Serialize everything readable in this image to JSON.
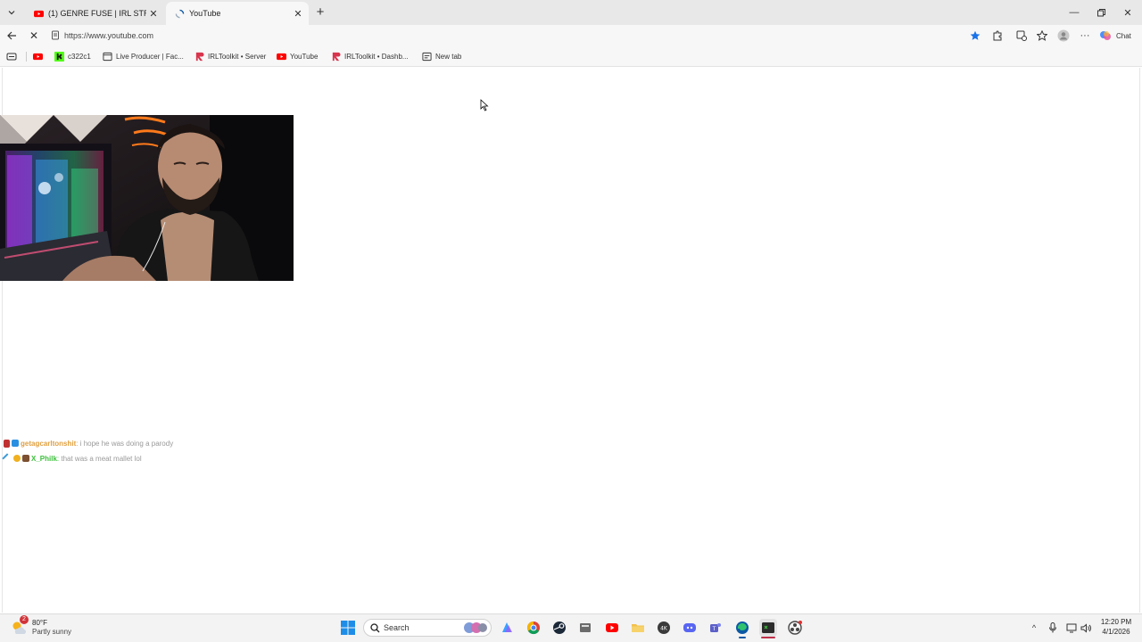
{
  "browser": {
    "tabs": [
      {
        "title": "(1) GENRE FUSE | IRL STREAM #ad",
        "icon": "youtube-icon",
        "active": false
      },
      {
        "title": "YouTube",
        "icon": "loading-spinner-icon",
        "active": true
      }
    ],
    "address": {
      "url": "https://www.youtube.com"
    },
    "chat_label": "Chat",
    "bookmarks": [
      {
        "label": "",
        "icon": "youtube-icon"
      },
      {
        "label": "c322c1",
        "icon": "kick-icon"
      },
      {
        "label": "Live Producer | Fac...",
        "icon": "page-icon"
      },
      {
        "label": "IRLToolkit • Server",
        "icon": "irltoolkit-icon"
      },
      {
        "label": "YouTube",
        "icon": "youtube-icon"
      },
      {
        "label": "IRLToolkit • Dashb...",
        "icon": "irltoolkit-icon"
      },
      {
        "label": "New tab",
        "icon": "new-tab-page-icon"
      }
    ]
  },
  "content": {
    "chat_messages": [
      {
        "user": "getagcarltonshit",
        "text": "i hope he was doing a parody",
        "user_color": "#e0a040"
      },
      {
        "user": "X_Philk",
        "text": "that was a meat mallet lol",
        "user_color": "#3cbf3c"
      }
    ]
  },
  "taskbar": {
    "weather": {
      "temp": "80°F",
      "condition": "Partly sunny",
      "badge": "2"
    },
    "search_placeholder": "Search",
    "clock": {
      "time": "12:20 PM",
      "date": "4/1/2026"
    }
  },
  "colors": {
    "youtube_red": "#ff0000",
    "kick_green": "#53fc18",
    "edge_blue": "#0c59a4",
    "star_blue": "#1a73e8"
  }
}
